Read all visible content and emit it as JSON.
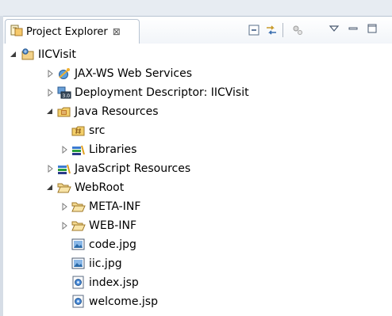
{
  "view": {
    "tab_title": "Project Explorer",
    "close_glyph": "⊠"
  },
  "toolbar": {
    "buttons": [
      "collapse-all-icon",
      "link-with-editor-icon",
      "filter-icon",
      "view-menu-icon",
      "minimize-icon",
      "maximize-icon"
    ]
  },
  "tree": {
    "items": [
      {
        "label": "IICVisit",
        "icon": "web-project-icon",
        "state": "expanded"
      },
      {
        "label": "JAX-WS Web Services",
        "icon": "web-services-icon",
        "state": "collapsed"
      },
      {
        "label": "Deployment Descriptor: IICVisit",
        "icon": "deployment-descriptor-icon",
        "state": "collapsed"
      },
      {
        "label": "Java Resources",
        "icon": "java-resources-icon",
        "state": "expanded"
      },
      {
        "label": "src",
        "icon": "source-folder-icon",
        "state": "leaf"
      },
      {
        "label": "Libraries",
        "icon": "libraries-icon",
        "state": "collapsed"
      },
      {
        "label": "JavaScript Resources",
        "icon": "libraries-icon",
        "state": "collapsed"
      },
      {
        "label": "WebRoot",
        "icon": "folder-open-icon",
        "state": "expanded"
      },
      {
        "label": "META-INF",
        "icon": "folder-icon",
        "state": "collapsed"
      },
      {
        "label": "WEB-INF",
        "icon": "folder-icon",
        "state": "collapsed"
      },
      {
        "label": "code.jpg",
        "icon": "image-file-icon",
        "state": "leaf"
      },
      {
        "label": "iic.jpg",
        "icon": "image-file-icon",
        "state": "leaf"
      },
      {
        "label": "index.jsp",
        "icon": "jsp-file-icon",
        "state": "leaf"
      },
      {
        "label": "welcome.jsp",
        "icon": "jsp-file-icon",
        "state": "leaf"
      }
    ]
  }
}
